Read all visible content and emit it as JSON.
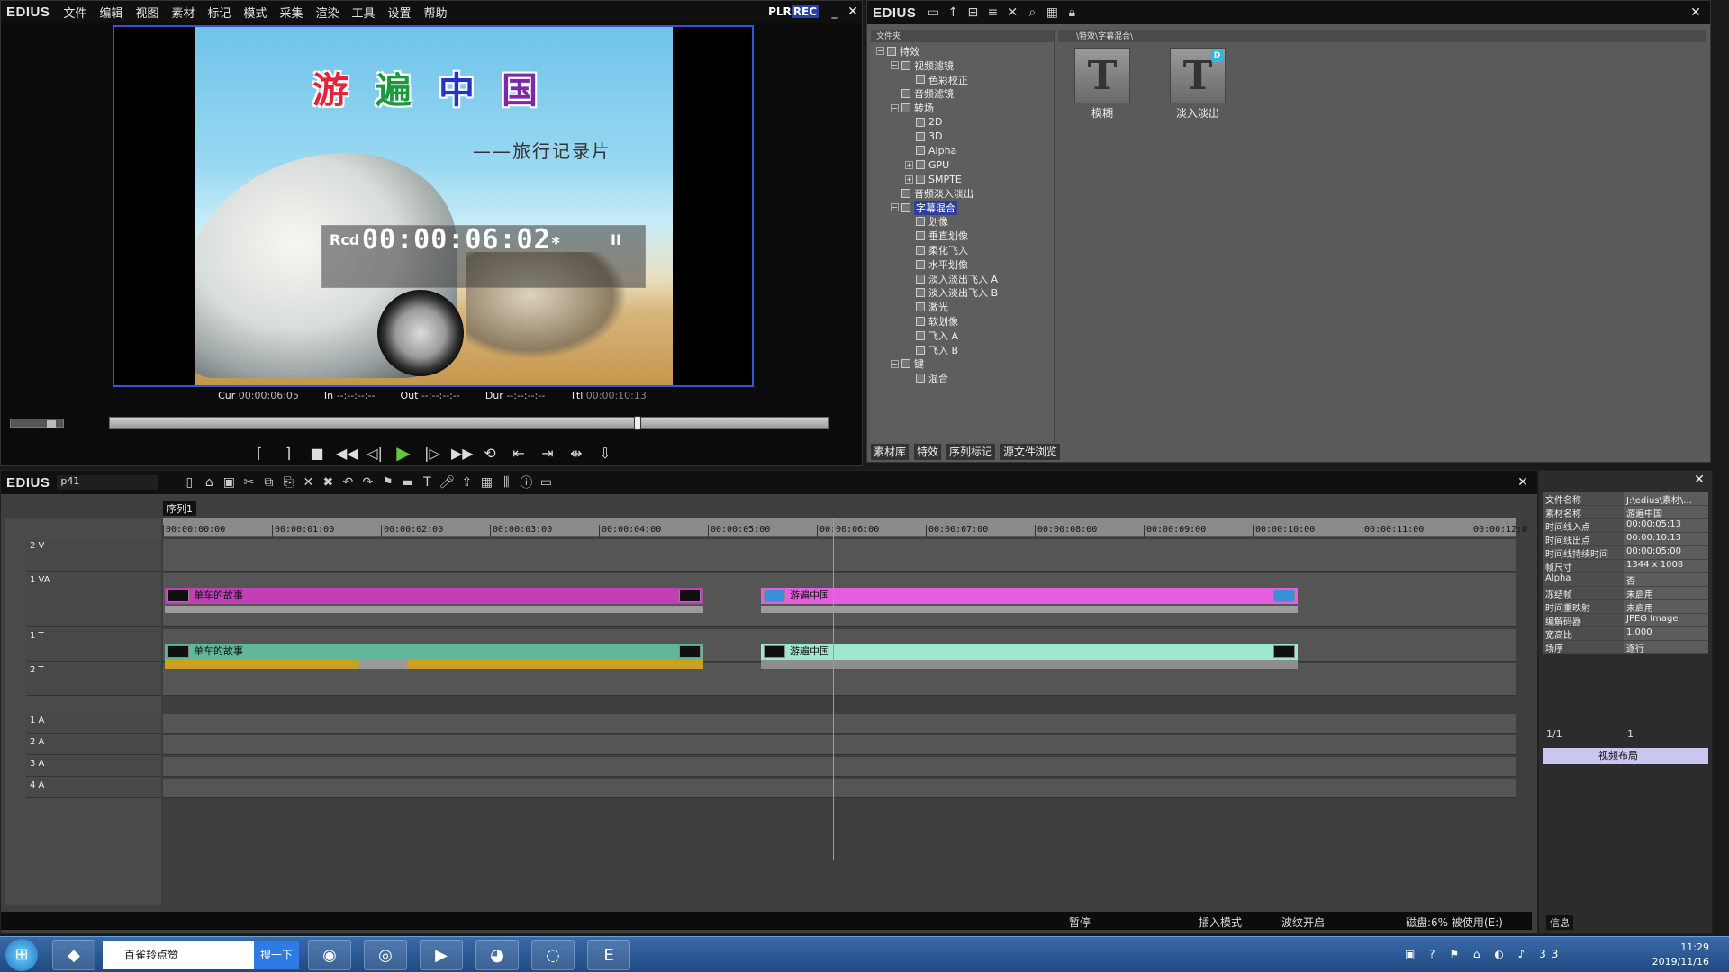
{
  "player": {
    "app_name": "EDIUS",
    "menu": [
      "文件",
      "编辑",
      "视图",
      "素材",
      "标记",
      "模式",
      "采集",
      "渲染",
      "工具",
      "设置",
      "帮助"
    ],
    "plr": "PLR",
    "rec": "REC",
    "overlay": {
      "title_chars": [
        "游",
        "遍",
        "中",
        "国"
      ],
      "title_colors": [
        "#e2243a",
        "#1a9a3a",
        "#2434c8",
        "#7a2aa8"
      ],
      "subtitle": "——旅行记录片",
      "rcd_label": "Rcd",
      "rcd_time": "00:00:06:02",
      "rcd_mark": "*",
      "pause": "II"
    },
    "timecodes": {
      "cur_label": "Cur",
      "cur": "00:00:06:05",
      "in_label": "In",
      "in": "--:--:--:--",
      "out_label": "Out",
      "out": "--:--:--:--",
      "dur_label": "Dur",
      "dur": "--:--:--:--",
      "ttl_label": "Ttl",
      "ttl": "00:00:10:13"
    }
  },
  "library": {
    "app_name": "EDIUS",
    "tree_header": "文件夹",
    "path": "\\特效\\字幕混合\\",
    "tree": [
      {
        "label": "特效",
        "indent": 0,
        "exp": "−"
      },
      {
        "label": "视频滤镜",
        "indent": 1,
        "exp": "−"
      },
      {
        "label": "色彩校正",
        "indent": 2,
        "exp": ""
      },
      {
        "label": "音频滤镜",
        "indent": 1,
        "exp": ""
      },
      {
        "label": "转场",
        "indent": 1,
        "exp": "−"
      },
      {
        "label": "2D",
        "indent": 2,
        "exp": ""
      },
      {
        "label": "3D",
        "indent": 2,
        "exp": ""
      },
      {
        "label": "Alpha",
        "indent": 2,
        "exp": ""
      },
      {
        "label": "GPU",
        "indent": 2,
        "exp": "+"
      },
      {
        "label": "SMPTE",
        "indent": 2,
        "exp": "+"
      },
      {
        "label": "音频淡入淡出",
        "indent": 1,
        "exp": ""
      },
      {
        "label": "字幕混合",
        "indent": 1,
        "exp": "−",
        "selected": true
      },
      {
        "label": "划像",
        "indent": 2,
        "exp": ""
      },
      {
        "label": "垂直划像",
        "indent": 2,
        "exp": ""
      },
      {
        "label": "柔化飞入",
        "indent": 2,
        "exp": ""
      },
      {
        "label": "水平划像",
        "indent": 2,
        "exp": ""
      },
      {
        "label": "淡入淡出飞入 A",
        "indent": 2,
        "exp": ""
      },
      {
        "label": "淡入淡出飞入 B",
        "indent": 2,
        "exp": ""
      },
      {
        "label": "激光",
        "indent": 2,
        "exp": ""
      },
      {
        "label": "软划像",
        "indent": 2,
        "exp": ""
      },
      {
        "label": "飞入 A",
        "indent": 2,
        "exp": ""
      },
      {
        "label": "飞入 B",
        "indent": 2,
        "exp": ""
      },
      {
        "label": "键",
        "indent": 1,
        "exp": "−"
      },
      {
        "label": "混合",
        "indent": 2,
        "exp": ""
      }
    ],
    "effects": [
      {
        "label": "模糊",
        "glyph": "T",
        "badge": ""
      },
      {
        "label": "淡入淡出",
        "glyph": "T",
        "badge": "D"
      }
    ],
    "tabs": [
      "素材库",
      "特效",
      "序列标记",
      "源文件浏览"
    ]
  },
  "timeline": {
    "app_name": "EDIUS",
    "project": "p41",
    "sequence_tab": "序列1",
    "ruler_ticks": [
      "00:00:00:00",
      "00:00:01:00",
      "00:00:02:00",
      "00:00:03:00",
      "00:00:04:00",
      "00:00:05:00",
      "00:00:06:00",
      "00:00:07:00",
      "00:00:08:00",
      "00:00:09:00",
      "00:00:10:00",
      "00:00:11:00",
      "00:00:12:0"
    ],
    "tracks": [
      {
        "name": "2 V"
      },
      {
        "name": "1 VA"
      },
      {
        "name": "1 T"
      },
      {
        "name": "2 T"
      },
      {
        "name": "1 A"
      },
      {
        "name": "2 A"
      },
      {
        "name": "3 A"
      },
      {
        "name": "4 A"
      }
    ],
    "clips": {
      "va_1": "单车的故事",
      "va_2": "游遍中国",
      "t_1": "单车的故事",
      "t_2": "游遍中国"
    },
    "status": {
      "pause": "暂停",
      "insert": "插入模式",
      "ripple": "波纹开启",
      "disk": "磁盘:6% 被使用(E:)"
    }
  },
  "info": {
    "rows": [
      {
        "k": "文件名称",
        "v": "J:\\edius\\素材\\..."
      },
      {
        "k": "素材名称",
        "v": "游遍中国"
      },
      {
        "k": "时间线入点",
        "v": "00:00:05:13"
      },
      {
        "k": "时间线出点",
        "v": "00:00:10:13"
      },
      {
        "k": "时间线持续时间",
        "v": "00:00:05:00"
      },
      {
        "k": "帧尺寸",
        "v": "1344 x 1008"
      },
      {
        "k": "Alpha",
        "v": "否"
      },
      {
        "k": "冻结帧",
        "v": "未启用"
      },
      {
        "k": "时间重映射",
        "v": "未启用"
      },
      {
        "k": "编解码器",
        "v": "JPEG Image"
      },
      {
        "k": "宽高比",
        "v": "1.000"
      },
      {
        "k": "场序",
        "v": "逐行"
      }
    ],
    "page": "1/1",
    "count": "1",
    "layout_label": "视频布局",
    "tab": "信息"
  },
  "taskbar": {
    "search_text": "百雀羚点赞",
    "search_btn": "搜一下",
    "time": "11:29",
    "date": "2019/11/16",
    "tray_badge": "33"
  }
}
